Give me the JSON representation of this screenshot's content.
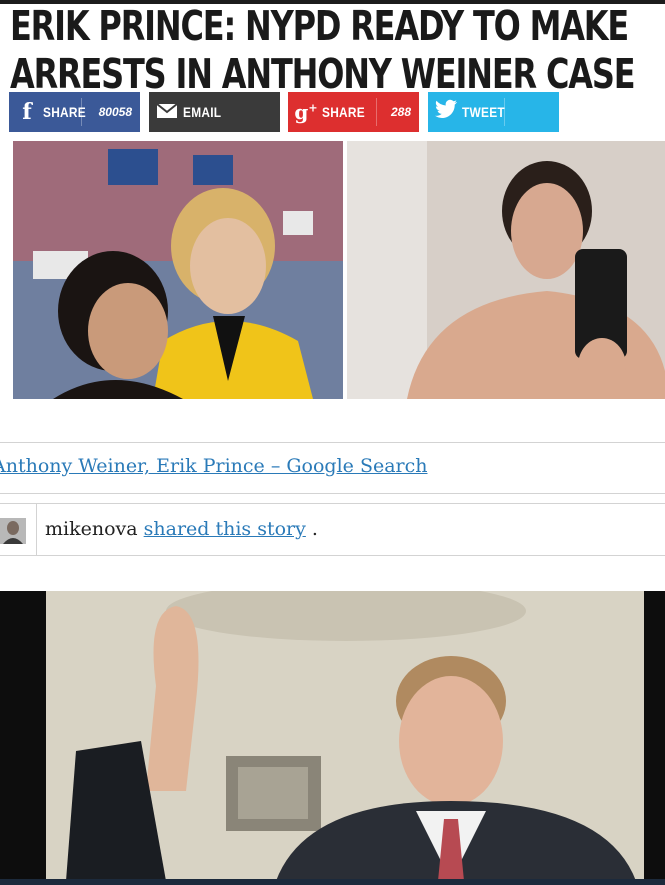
{
  "article": {
    "title_line1": "ERIK PRINCE: NYPD READY TO MAKE",
    "title_line2": "ARRESTS IN ANTHONY WEINER CASE"
  },
  "share": {
    "facebook": {
      "label": "SHARE",
      "count": "80058",
      "icon": "facebook-icon",
      "color": "#3b5998"
    },
    "email": {
      "label": "EMAIL",
      "icon": "envelope-icon",
      "color": "#3a3a3a"
    },
    "googleplus": {
      "label": "SHARE",
      "count": "288",
      "icon": "google-plus-icon",
      "color": "#dd2f2f"
    },
    "twitter": {
      "label": "TWEET",
      "icon": "twitter-bird-icon",
      "color": "#27b5e8"
    }
  },
  "search_link": "Anthony Weiner, Erik Prince – Google Search",
  "shared": {
    "user": "mikenova",
    "link": "shared this story",
    "suffix": "."
  }
}
